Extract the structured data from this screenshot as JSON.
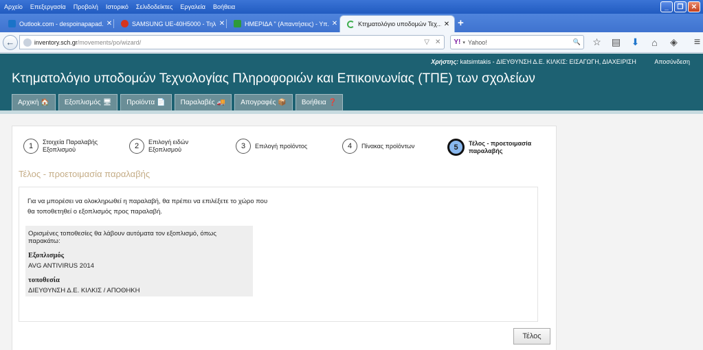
{
  "browser": {
    "menu": [
      "Αρχείο",
      "Επεξεργασία",
      "Προβολή",
      "Ιστορικό",
      "Σελιδοδείκτες",
      "Εργαλεία",
      "Βοήθεια"
    ],
    "tabs": [
      {
        "label": "Outlook.com - despoinapapad...",
        "icon_color": "#1a73c8",
        "icon": "outlook-icon"
      },
      {
        "label": "SAMSUNG UE-40H5000 - Τηλ...",
        "icon_color": "#d6341c",
        "icon": "samsung-icon"
      },
      {
        "label": "ΗΜΕΡΙΔΑ \" (Απαντήσεις) - Υπ...",
        "icon_color": "#2e9a3b",
        "icon": "sheets-icon"
      },
      {
        "label": "Κτηματολόγιο υποδομών Τεχ...",
        "icon_color": "#3fae4f",
        "icon": "loading-icon"
      }
    ],
    "url_host": "inventory.sch.gr",
    "url_path": "/movements/po/wizard/",
    "search_text": "Yahoo!"
  },
  "header": {
    "user_label": "Χρήστης:",
    "user_value": " katsimtakis - ΔΙΕΥΘΥΝΣΗ Δ.Ε. ΚΙΛΚΙΣ: ΕΙΣΑΓΩΓΗ, ΔΙΑΧΕΙΡΙΣΗ",
    "logout": "Αποσύνδεση",
    "title": "Κτηματολόγιο υποδομών Τεχνολογίας Πληροφοριών και Επικοινωνίας (ΤΠΕ) των σχολείων",
    "nav": [
      {
        "label": "Αρχική",
        "icon": "🏠"
      },
      {
        "label": "Εξοπλισμός",
        "icon": "🖥"
      },
      {
        "label": "Προϊόντα",
        "icon": "📄"
      },
      {
        "label": "Παραλαβές",
        "icon": "🚚"
      },
      {
        "label": "Απογραφές",
        "icon": "📦"
      },
      {
        "label": "Βοήθεια",
        "icon": "❓"
      }
    ]
  },
  "wizard": {
    "steps": [
      {
        "num": "1",
        "label": "Στοιχεία Παραλαβής Εξοπλισμού"
      },
      {
        "num": "2",
        "label": "Επιλογή ειδών Εξοπλισμού"
      },
      {
        "num": "3",
        "label": "Επιλογή προϊόντος"
      },
      {
        "num": "4",
        "label": "Πίνακας προϊόντων"
      },
      {
        "num": "5",
        "label": "Τέλος - προετοιμασία παραλαβής"
      }
    ],
    "active_step": 5
  },
  "content": {
    "section_title": "Τέλος - προετοιμασία παραλαβής",
    "intro": "Για να μπορέσει να ολοκληρωθεί η παραλαβή, θα πρέπει να επιλέξετε το χώρο που θα τοποθετηθεί ο εξοπλισμός προς παραλαβή.",
    "note": "Ορισμένες τοποθεσίες θα λάβουν αυτόματα τον εξοπλισμό, όπως παρακάτω:",
    "equipment_label": "Εξοπλισμός",
    "equipment_value": "AVG ANTIVIRUS 2014",
    "location_label": "τοποθεσία",
    "location_value": "ΔΙΕΥΘΥΝΣΗ Δ.Ε. ΚΙΛΚΙΣ / ΑΠΟΘΗΚΗ",
    "finish_button": "Τέλος"
  }
}
